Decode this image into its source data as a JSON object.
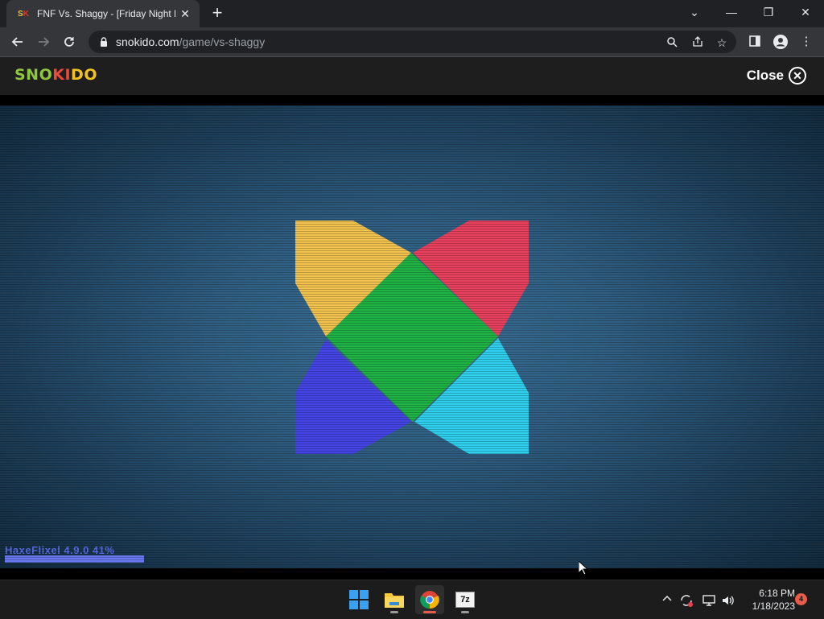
{
  "browser": {
    "tab": {
      "title": "FNF Vs. Shaggy - [Friday Night Fu",
      "favicon": "snokido-favicon"
    },
    "new_tab_label": "+",
    "window_controls": {
      "tab_search": "⌄",
      "minimize": "—",
      "restore": "❐",
      "close": "✕"
    },
    "address": {
      "domain": "snokido.com",
      "path": "/game/vs-shaggy"
    }
  },
  "site": {
    "logo_text": {
      "part1": "SNO",
      "part2": "KI",
      "part3": "DO"
    },
    "close_label": "Close",
    "close_glyph": "✕"
  },
  "game": {
    "loader_text": "HaxeFlixel 4.9.0 41%",
    "loader_progress": 0.41,
    "logo_colors": {
      "top_left": "#f2c24f",
      "top_right": "#e8415e",
      "center": "#1fb346",
      "bottom_left": "#4545e6",
      "bottom_right": "#2fd0ee"
    }
  },
  "taskbar": {
    "apps": [
      "start-button",
      "file-explorer",
      "chrome",
      "7zip"
    ],
    "sevenzip_label": "7z",
    "clock_time": "6:18 PM",
    "clock_date": "1/18/2023",
    "notification_count": "4"
  }
}
